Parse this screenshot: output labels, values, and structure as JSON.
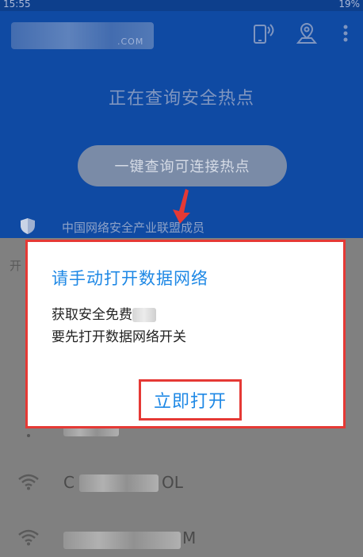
{
  "status": {
    "time": "15:55",
    "right": "19%"
  },
  "header": {
    "logo_suffix": ".COM"
  },
  "main": {
    "headline": "正在查询安全热点",
    "query_button": "一键查询可连接热点",
    "member_text": "中国网络安全产业联盟成员"
  },
  "list": {
    "header": "开",
    "items": [
      {
        "ssid_visible": "",
        "icon": "wifi-icon"
      },
      {
        "ssid_visible": "C",
        "suffix": "OL",
        "icon": "wifi-icon"
      },
      {
        "ssid_visible": "",
        "suffix": "M",
        "icon": "wifi-icon"
      }
    ]
  },
  "dialog": {
    "title": "请手动打开数据网络",
    "line1": "获取安全免费",
    "line2": "要先打开数据网络开关",
    "button": "立即打开"
  },
  "colors": {
    "accent": "#1e88e5",
    "annotation": "#e53935",
    "top_bg": "#0f4aa3"
  }
}
